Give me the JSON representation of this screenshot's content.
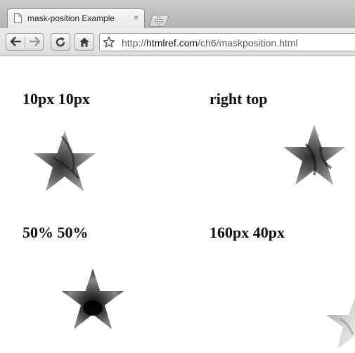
{
  "browser": {
    "tab": {
      "title": "mask-position Example",
      "close_glyph": "×"
    },
    "new_tab_icon": "plus-icon",
    "toolbar": {
      "back_icon": "arrow-left-icon",
      "forward_icon": "arrow-right-icon",
      "reload_icon": "reload-icon",
      "home_icon": "home-icon",
      "bookmark_icon": "star-outline-icon"
    },
    "address": {
      "prefix": "http://",
      "host": "htmlref.com",
      "path": "/ch6/maskposition.html"
    }
  },
  "examples": [
    {
      "label": "10px 10px"
    },
    {
      "label": "right top"
    },
    {
      "label": "50% 50%"
    },
    {
      "label": "160px 40px"
    }
  ],
  "colors": {
    "tabstrip": "#bdbdbd",
    "page_background": "#ffffff",
    "label_text": "#111111"
  }
}
